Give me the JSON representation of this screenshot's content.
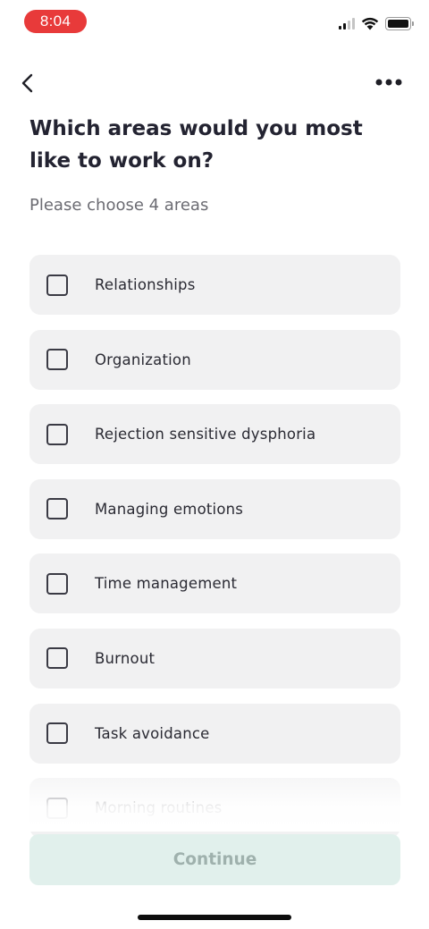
{
  "status_bar": {
    "time": "8:04",
    "time_pill_color": "#e83a3a",
    "icons": [
      "signal-icon",
      "wifi-icon",
      "battery-icon"
    ]
  },
  "nav": {
    "back_icon": "chevron-left-icon",
    "more_icon": "more-horizontal-icon"
  },
  "page": {
    "title": "Which areas would you most like to work on?",
    "subtitle": "Please choose 4 areas"
  },
  "options": [
    {
      "label": "Relationships",
      "checked": false
    },
    {
      "label": "Organization",
      "checked": false
    },
    {
      "label": "Rejection sensitive dysphoria",
      "checked": false
    },
    {
      "label": "Managing emotions",
      "checked": false
    },
    {
      "label": "Time management",
      "checked": false
    },
    {
      "label": "Burnout",
      "checked": false
    },
    {
      "label": "Task avoidance",
      "checked": false
    },
    {
      "label": "Morning routines",
      "checked": false
    }
  ],
  "footer": {
    "continue_label": "Continue",
    "continue_bg": "#e1f0ec",
    "continue_text_color": "#9fb1ad"
  }
}
